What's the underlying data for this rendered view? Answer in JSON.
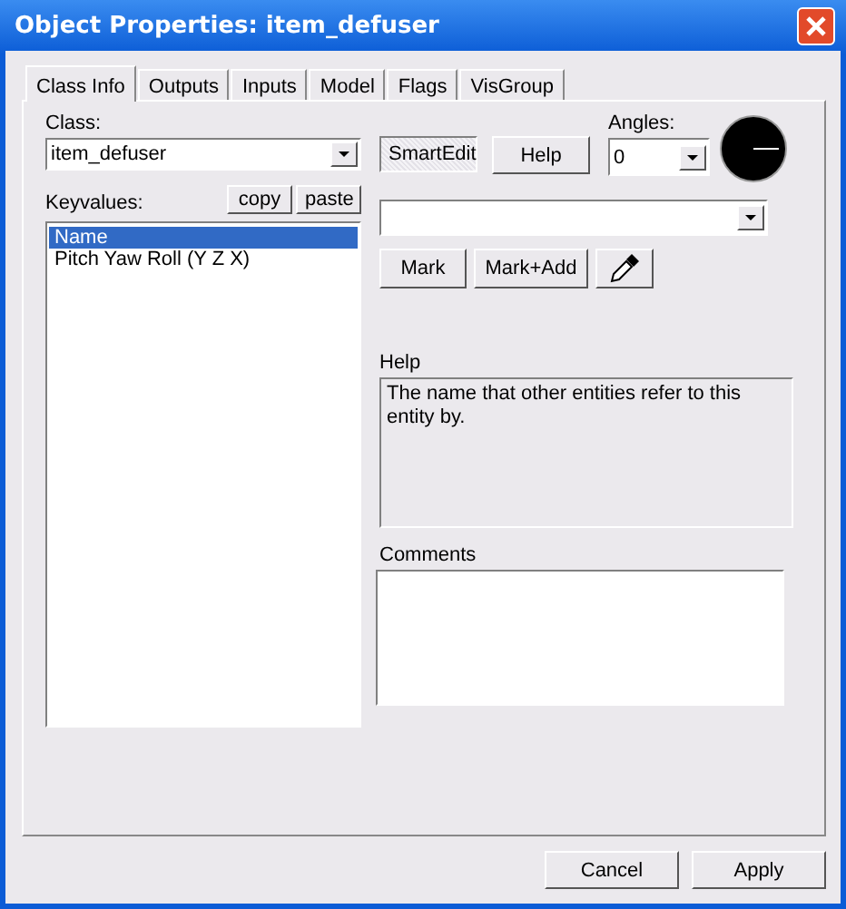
{
  "window": {
    "title": "Object Properties: item_defuser"
  },
  "tabs": [
    {
      "label": "Class Info",
      "selected": true
    },
    {
      "label": "Outputs",
      "selected": false
    },
    {
      "label": "Inputs",
      "selected": false
    },
    {
      "label": "Model",
      "selected": false
    },
    {
      "label": "Flags",
      "selected": false
    },
    {
      "label": "VisGroup",
      "selected": false
    }
  ],
  "class_label": "Class:",
  "class_value": "item_defuser",
  "smart_edit": {
    "label": "SmartEdit",
    "pressed": true
  },
  "help_button": "Help",
  "angles": {
    "label": "Angles:",
    "value": "0"
  },
  "keyvalues": {
    "label": "Keyvalues:",
    "copy": "copy",
    "paste": "paste",
    "items": [
      {
        "label": "Name",
        "selected": true
      },
      {
        "label": "Pitch Yaw Roll (Y Z X)",
        "selected": false
      }
    ]
  },
  "mark_buttons": [
    "Mark",
    "Mark+Add"
  ],
  "help": {
    "label": "Help",
    "text": "The name that other entities refer to this entity by."
  },
  "comments": {
    "label": "Comments"
  },
  "footer_buttons": [
    "Cancel",
    "Apply"
  ]
}
